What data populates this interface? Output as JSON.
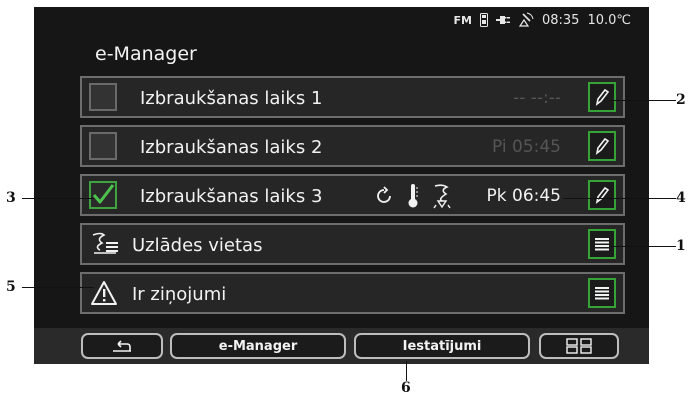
{
  "status": {
    "fm": "FM",
    "clock": "08:35",
    "temp": "10.0℃"
  },
  "title": "e-Manager",
  "rows": [
    {
      "label": "Izbraukšanas laiks 1",
      "time": "-- --:--"
    },
    {
      "label": "Izbraukšanas laiks 2",
      "time": "Pi 05:45"
    },
    {
      "label": "Izbraukšanas laiks 3",
      "time": "Pk 06:45"
    },
    {
      "label": "Uzlādes vietas"
    },
    {
      "label": "Ir ziņojumi"
    }
  ],
  "bottom": {
    "emanager": "e-Manager",
    "settings": "Iestatījumi"
  },
  "callouts": [
    "1",
    "2",
    "3",
    "4",
    "5",
    "6"
  ],
  "colors": {
    "accent": "#3fa33f",
    "background": "#161616"
  }
}
